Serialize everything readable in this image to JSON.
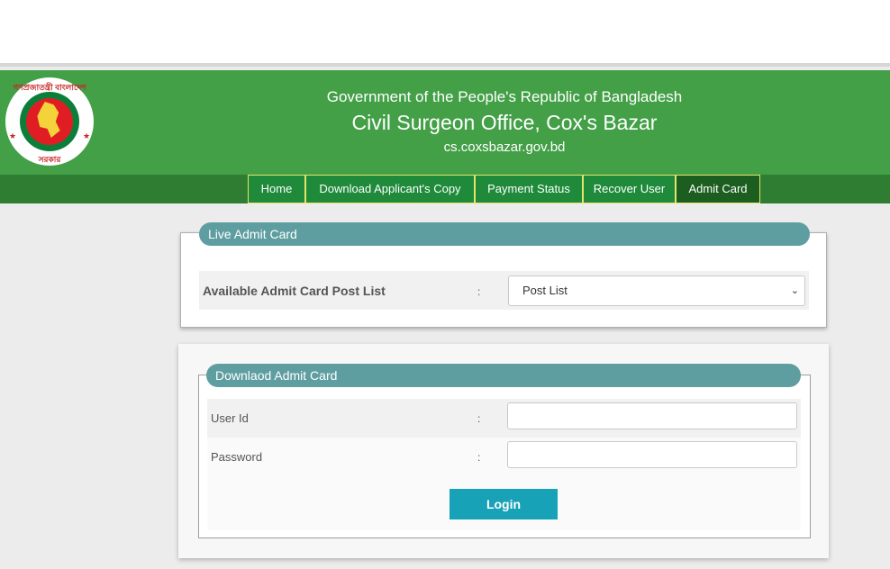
{
  "header": {
    "line1": "Government of the People's Republic of Bangladesh",
    "line2": "Civil Surgeon Office, Cox's Bazar",
    "line3": "cs.coxsbazar.gov.bd",
    "logo_top_text": "গণপ্রজাতন্ত্রী বাংলাদেশ",
    "logo_bottom_text": "সরকার"
  },
  "nav": {
    "items": [
      "Home",
      "Download Applicant's Copy",
      "Payment Status",
      "Recover User",
      "Admit Card"
    ],
    "active": "Admit Card"
  },
  "live_card": {
    "title": "Live Admit Card",
    "label": "Available Admit Card Post List",
    "colon": ":",
    "select_value": "Post List"
  },
  "download_card": {
    "title": "Downlaod Admit Card",
    "user_label": "User Id",
    "password_label": "Password",
    "colon": ":",
    "user_value": "",
    "password_value": "",
    "login_label": "Login"
  },
  "colors": {
    "header_green": "#43a047",
    "nav_green": "#1e8a3a",
    "pill_teal": "#5f9ea0",
    "button_teal": "#17a2b8"
  }
}
